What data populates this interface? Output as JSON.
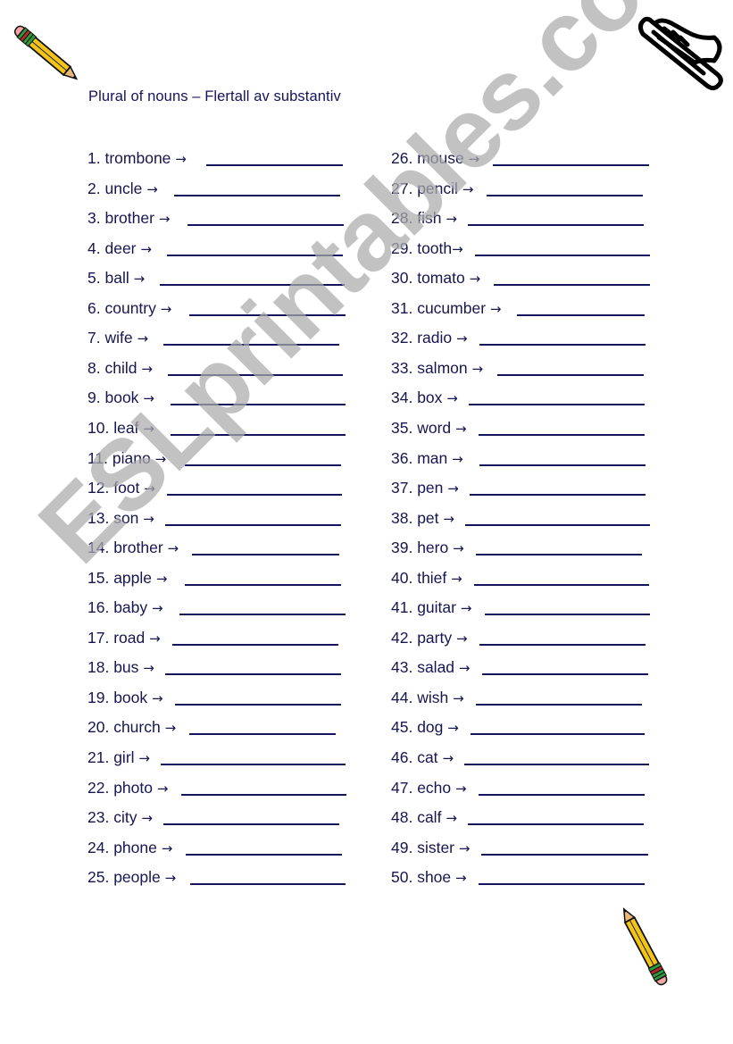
{
  "document": {
    "title": "Plural of nouns – Flertall av substantiv",
    "watermark": "ESLprintables.com",
    "arrow_glyph": "→",
    "colors": {
      "text": "#14145c",
      "watermark": "#aaaaaa",
      "pencil_body": "#f2c41a",
      "pencil_band": "#2e9b3c",
      "pencil_band_red": "#b52a24",
      "pencil_eraser": "#f3a5a5"
    },
    "icons": {
      "top_left": "pencil-icon",
      "top_right": "trombone-icon",
      "bottom_right": "pencil-icon"
    }
  },
  "items": [
    {
      "n": "1.",
      "word": "trombone"
    },
    {
      "n": "2.",
      "word": "uncle"
    },
    {
      "n": "3.",
      "word": "brother"
    },
    {
      "n": "4.",
      "word": "deer"
    },
    {
      "n": "5.",
      "word": "ball"
    },
    {
      "n": "6.",
      "word": "country"
    },
    {
      "n": "7.",
      "word": "wife"
    },
    {
      "n": "8.",
      "word": "child"
    },
    {
      "n": "9.",
      "word": "book"
    },
    {
      "n": "10.",
      "word": "leaf"
    },
    {
      "n": "11.",
      "word": "piano"
    },
    {
      "n": "12.",
      "word": "foot"
    },
    {
      "n": "13.",
      "word": "son"
    },
    {
      "n": "14.",
      "word": "brother"
    },
    {
      "n": "15.",
      "word": "apple"
    },
    {
      "n": "16.",
      "word": "baby"
    },
    {
      "n": "17.",
      "word": "road"
    },
    {
      "n": "18.",
      "word": "bus"
    },
    {
      "n": "19.",
      "word": "book"
    },
    {
      "n": "20.",
      "word": "church"
    },
    {
      "n": "21.",
      "word": "girl"
    },
    {
      "n": "22.",
      "word": "photo"
    },
    {
      "n": "23.",
      "word": "city"
    },
    {
      "n": "24.",
      "word": "phone"
    },
    {
      "n": "25.",
      "word": "people"
    },
    {
      "n": "26.",
      "word": "mouse"
    },
    {
      "n": "27.",
      "word": "pencil"
    },
    {
      "n": "28.",
      "word": "fish"
    },
    {
      "n": "29.",
      "word": "tooth"
    },
    {
      "n": "30.",
      "word": "tomato"
    },
    {
      "n": "31.",
      "word": "cucumber"
    },
    {
      "n": "32.",
      "word": "radio"
    },
    {
      "n": "33.",
      "word": "salmon"
    },
    {
      "n": "34.",
      "word": "box"
    },
    {
      "n": "35.",
      "word": "word"
    },
    {
      "n": "36.",
      "word": "man"
    },
    {
      "n": "37.",
      "word": "pen"
    },
    {
      "n": "38.",
      "word": "pet"
    },
    {
      "n": "39.",
      "word": "hero"
    },
    {
      "n": "40.",
      "word": "thief"
    },
    {
      "n": "41.",
      "word": "guitar"
    },
    {
      "n": "42.",
      "word": "party"
    },
    {
      "n": "43.",
      "word": "salad"
    },
    {
      "n": "44.",
      "word": "wish"
    },
    {
      "n": "45.",
      "word": "dog"
    },
    {
      "n": "46.",
      "word": "cat"
    },
    {
      "n": "47.",
      "word": "echo"
    },
    {
      "n": "48.",
      "word": "calf"
    },
    {
      "n": "49.",
      "word": "sister"
    },
    {
      "n": "50.",
      "word": "shoe"
    }
  ]
}
